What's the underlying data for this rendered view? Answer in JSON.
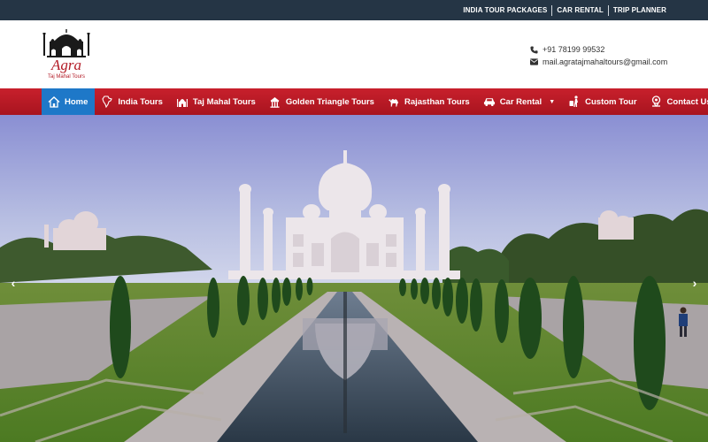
{
  "topbar": {
    "links": [
      "INDIA TOUR PACKAGES",
      "CAR RENTAL",
      "TRIP PLANNER"
    ]
  },
  "logo": {
    "title": "Agra",
    "subtitle": "Taj Mahal Tours"
  },
  "contact": {
    "phone": "+91 78199 99532",
    "email": "mail.agratajmahaltours@gmail.com"
  },
  "nav": {
    "items": [
      {
        "label": "Home",
        "icon": "home-icon"
      },
      {
        "label": "India Tours",
        "icon": "india-map-icon"
      },
      {
        "label": "Taj Mahal Tours",
        "icon": "taj-mahal-icon"
      },
      {
        "label": "Golden Triangle Tours",
        "icon": "temple-icon"
      },
      {
        "label": "Rajasthan Tours",
        "icon": "camel-icon"
      },
      {
        "label": "Car Rental",
        "icon": "car-icon"
      },
      {
        "label": "Custom Tour",
        "icon": "traveler-icon"
      },
      {
        "label": "Contact Us",
        "icon": "contact-icon"
      }
    ]
  },
  "hero": {
    "image": "Taj Mahal with reflecting pool and gardens",
    "prev_icon": "chevron-left-icon",
    "next_icon": "chevron-right-icon"
  },
  "colors": {
    "topbar": "#253545",
    "nav": "#b8171f",
    "nav_active": "#1e78c8",
    "accent": "#b21a25"
  }
}
